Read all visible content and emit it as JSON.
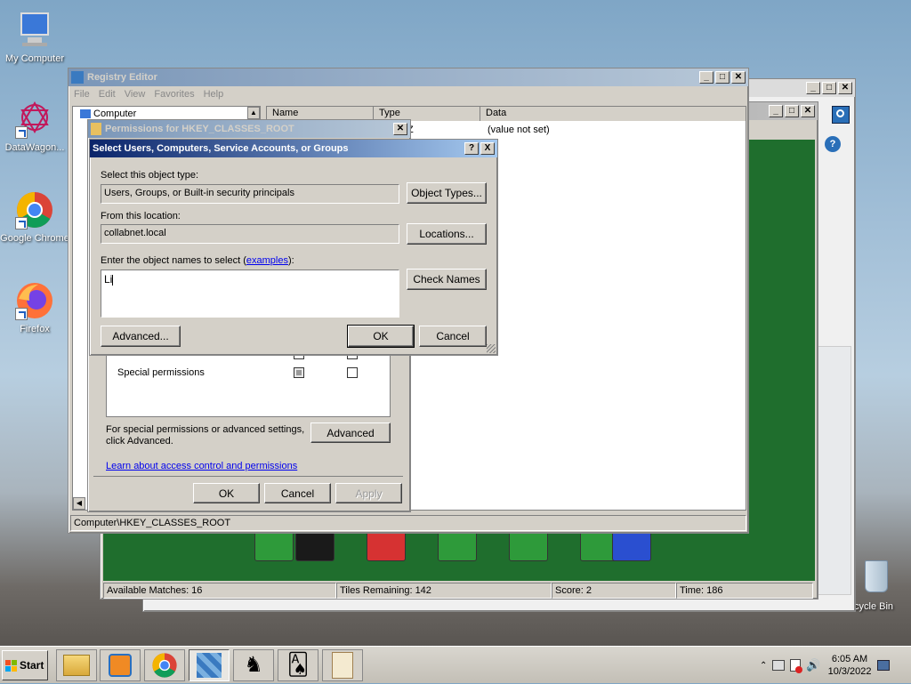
{
  "desktop": {
    "icons": [
      {
        "label": "My Computer"
      },
      {
        "label": "DataWagon..."
      },
      {
        "label": "Google Chrome"
      },
      {
        "label": "Firefox"
      },
      {
        "label": "cycle Bin"
      }
    ]
  },
  "game": {
    "status": {
      "available_matches": "Available Matches: 16",
      "tiles_remaining": "Tiles Remaining: 142",
      "score": "Score: 2",
      "time": "Time: 186"
    }
  },
  "registry": {
    "title": "Registry Editor",
    "menu": [
      "File",
      "Edit",
      "View",
      "Favorites",
      "Help"
    ],
    "tree_root": "Computer",
    "columns": [
      "Name",
      "Type",
      "Data"
    ],
    "row_type_partial": "Z",
    "row_data": "(value not set)",
    "statusbar": "Computer\\HKEY_CLASSES_ROOT"
  },
  "permissions": {
    "title": "Permissions for HKEY_CLASSES_ROOT",
    "perm_read_partial": "Read",
    "perm_special": "Special permissions",
    "advanced_note_line1": "For special permissions or advanced settings,",
    "advanced_note_line2": "click Advanced.",
    "advanced_button": "Advanced",
    "learn_link": "Learn about access control and permissions",
    "ok": "OK",
    "cancel": "Cancel",
    "apply": "Apply"
  },
  "select_dialog": {
    "title": "Select Users, Computers, Service Accounts, or Groups",
    "object_type_label": "Select this object type:",
    "object_type_value": "Users, Groups, or Built-in security principals",
    "object_types_button": "Object Types...",
    "location_label": "From this location:",
    "location_value": "collabnet.local",
    "locations_button": "Locations...",
    "names_label_prefix": "Enter the object names to select (",
    "names_label_link": "examples",
    "names_label_suffix": "):",
    "names_value": "Li",
    "check_names_button": "Check Names",
    "advanced_button": "Advanced...",
    "ok": "OK",
    "cancel": "Cancel",
    "help_glyph": "?",
    "close_glyph": "X"
  },
  "taskbar": {
    "start": "Start",
    "time": "6:05 AM",
    "date": "10/3/2022"
  },
  "colors": {
    "game_felt": "#1f6e2d",
    "title_active": "#0a246a",
    "title_inactive": "#808080"
  }
}
